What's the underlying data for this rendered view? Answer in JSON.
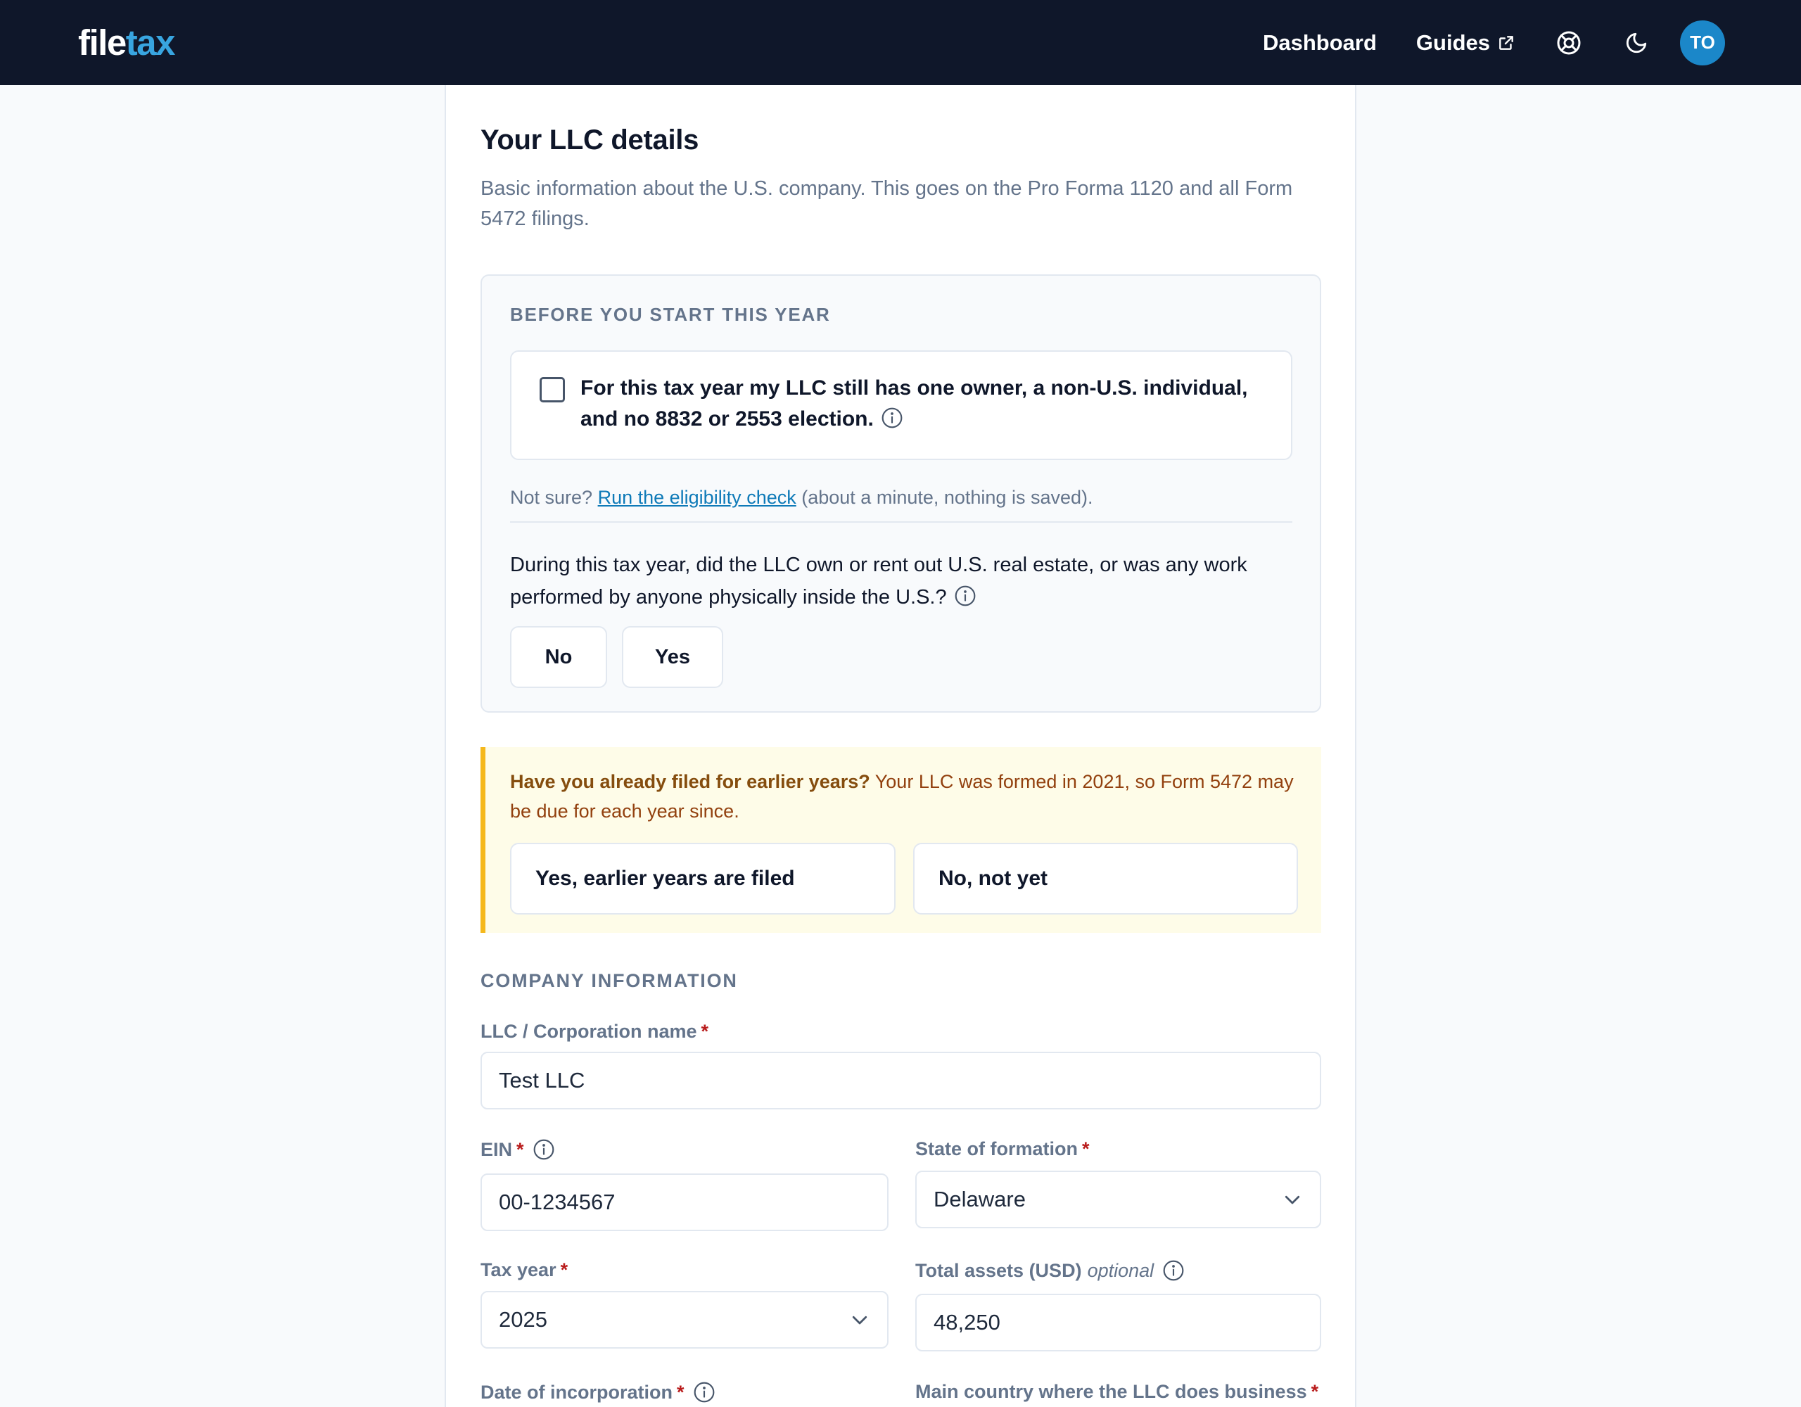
{
  "header": {
    "logo_part1": "file",
    "logo_part2": "tax",
    "nav": {
      "dashboard": "Dashboard",
      "guides": "Guides"
    },
    "icons": {
      "external_link": "external-link-icon",
      "help": "lifebuoy-icon",
      "theme": "moon-icon"
    },
    "avatar_initials": "TO"
  },
  "page": {
    "title": "Your LLC details",
    "subtitle": "Basic information about the U.S. company. This goes on the Pro Forma 1120 and all Form 5472 filings."
  },
  "before_start": {
    "kicker": "BEFORE YOU START THIS YEAR",
    "confirm_text": "For this tax year my LLC still has one owner, a non-U.S. individual, and no 8832 or 2553 election.",
    "confirm_checked": false,
    "not_sure_prefix": "Not sure?",
    "eligibility_link": "Run the eligibility check",
    "not_sure_suffix": "(about a minute, nothing is saved).",
    "question": "During this tax year, did the LLC own or rent out U.S. real estate, or was any work performed by anyone physically inside the U.S.?",
    "answer_no": "No",
    "answer_yes": "Yes"
  },
  "earlier_years": {
    "title": "Have you already filed for earlier years?",
    "body": "Your LLC was formed in 2021, so Form 5472 may be due for each year since.",
    "option_filed": "Yes, earlier years are filed",
    "option_not_yet": "No, not yet"
  },
  "company": {
    "kicker": "COMPANY INFORMATION",
    "required_mark": "*",
    "name_label": "LLC / Corporation name",
    "name_value": "Test LLC",
    "ein_label": "EIN",
    "ein_value": "00-1234567",
    "state_label": "State of formation",
    "state_value": "Delaware",
    "tax_year_label": "Tax year",
    "tax_year_value": "2025",
    "assets_label": "Total assets (USD)",
    "assets_optional": "optional",
    "assets_value": "48,250",
    "incorporation_label": "Date of incorporation",
    "country_label": "Main country where the LLC does business"
  },
  "colors": {
    "header_bg": "#0f172a",
    "brand_blue": "#38a5e0",
    "avatar_bg": "#1b87c9",
    "link": "#0e7ab8",
    "alert_bg": "#fefce8",
    "alert_border": "#f5b81c",
    "required": "#b91c1c"
  }
}
